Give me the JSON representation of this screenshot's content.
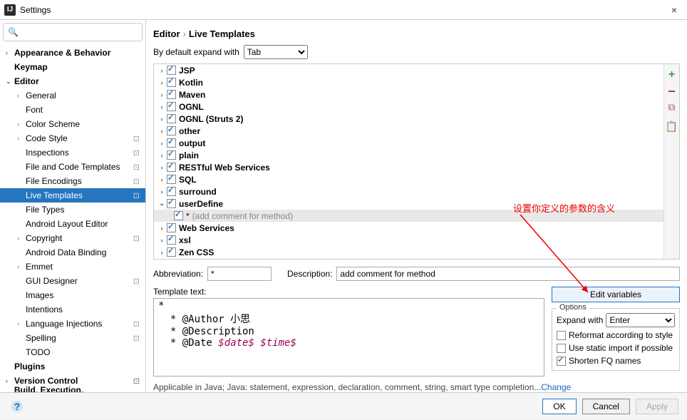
{
  "window": {
    "title": "Settings",
    "icon_text": "IJ"
  },
  "search": {
    "placeholder": ""
  },
  "sidebar": {
    "items": [
      {
        "label": "Appearance & Behavior",
        "level": 1,
        "arrow": "›",
        "bold": true
      },
      {
        "label": "Keymap",
        "level": 1,
        "arrow": "",
        "bold": true
      },
      {
        "label": "Editor",
        "level": 1,
        "arrow": "⌄",
        "bold": true
      },
      {
        "label": "General",
        "level": 2,
        "arrow": "›",
        "gear": false
      },
      {
        "label": "Font",
        "level": 2,
        "arrow": ""
      },
      {
        "label": "Color Scheme",
        "level": 2,
        "arrow": "›"
      },
      {
        "label": "Code Style",
        "level": 2,
        "arrow": "›",
        "gear": true
      },
      {
        "label": "Inspections",
        "level": 2,
        "arrow": "",
        "gear": true
      },
      {
        "label": "File and Code Templates",
        "level": 2,
        "arrow": "",
        "gear": true
      },
      {
        "label": "File Encodings",
        "level": 2,
        "arrow": "",
        "gear": true
      },
      {
        "label": "Live Templates",
        "level": 2,
        "arrow": "",
        "gear": true,
        "selected": true
      },
      {
        "label": "File Types",
        "level": 2,
        "arrow": ""
      },
      {
        "label": "Android Layout Editor",
        "level": 2,
        "arrow": ""
      },
      {
        "label": "Copyright",
        "level": 2,
        "arrow": "›",
        "gear": true
      },
      {
        "label": "Android Data Binding",
        "level": 2,
        "arrow": ""
      },
      {
        "label": "Emmet",
        "level": 2,
        "arrow": "›"
      },
      {
        "label": "GUI Designer",
        "level": 2,
        "arrow": "",
        "gear": true
      },
      {
        "label": "Images",
        "level": 2,
        "arrow": ""
      },
      {
        "label": "Intentions",
        "level": 2,
        "arrow": ""
      },
      {
        "label": "Language Injections",
        "level": 2,
        "arrow": "›",
        "gear": true
      },
      {
        "label": "Spelling",
        "level": 2,
        "arrow": "",
        "gear": true
      },
      {
        "label": "TODO",
        "level": 2,
        "arrow": ""
      },
      {
        "label": "Plugins",
        "level": 1,
        "arrow": "",
        "bold": true
      },
      {
        "label": "Version Control",
        "level": 1,
        "arrow": "›",
        "bold": true,
        "gear": true
      },
      {
        "label": "Build, Execution, Deployment",
        "level": 1,
        "arrow": "›",
        "bold": true,
        "gear": true
      }
    ]
  },
  "breadcrumb": {
    "part1": "Editor",
    "part2": "Live Templates"
  },
  "expand": {
    "label": "By default expand with",
    "value": "Tab"
  },
  "templates": [
    {
      "label": "JSP",
      "checked": true,
      "arrow": "›"
    },
    {
      "label": "Kotlin",
      "checked": true,
      "arrow": "›"
    },
    {
      "label": "Maven",
      "checked": true,
      "arrow": "›"
    },
    {
      "label": "OGNL",
      "checked": true,
      "arrow": "›"
    },
    {
      "label": "OGNL (Struts 2)",
      "checked": true,
      "arrow": "›"
    },
    {
      "label": "other",
      "checked": true,
      "arrow": "›"
    },
    {
      "label": "output",
      "checked": true,
      "arrow": "›"
    },
    {
      "label": "plain",
      "checked": true,
      "arrow": "›"
    },
    {
      "label": "RESTful Web Services",
      "checked": true,
      "arrow": "›"
    },
    {
      "label": "SQL",
      "checked": true,
      "arrow": "›"
    },
    {
      "label": "surround",
      "checked": true,
      "arrow": "›"
    },
    {
      "label": "userDefine",
      "checked": true,
      "arrow": "⌄",
      "children": [
        {
          "label": "*",
          "desc": "(add comment for method)",
          "checked": true
        }
      ]
    },
    {
      "label": "Web Services",
      "checked": true,
      "arrow": "›"
    },
    {
      "label": "xsl",
      "checked": true,
      "arrow": "›"
    },
    {
      "label": "Zen CSS",
      "checked": true,
      "arrow": "›"
    }
  ],
  "form": {
    "abbr_label": "Abbreviation:",
    "abbr_value": "*",
    "desc_label": "Description:",
    "desc_value": "add comment for method"
  },
  "template_text": {
    "label": "Template text:",
    "line1": "*",
    "line2": "  * @Author 小思",
    "line3": "  * @Description",
    "line4_prefix": "  * @Date ",
    "line4_var1": "$date$",
    "line4_var2": "$time$"
  },
  "edit_variables": "Edit variables",
  "options": {
    "legend": "Options",
    "expand_label": "Expand with",
    "expand_value": "Enter",
    "reformat": "Reformat according to style",
    "static_import": "Use static import if possible",
    "shorten": "Shorten FQ names"
  },
  "applicable": {
    "text": "Applicable in Java; Java: statement, expression, declaration, comment, string, smart type completion...",
    "change": "Change"
  },
  "footer": {
    "ok": "OK",
    "cancel": "Cancel",
    "apply": "Apply"
  },
  "annotation": "设置你定义的参数的含义"
}
